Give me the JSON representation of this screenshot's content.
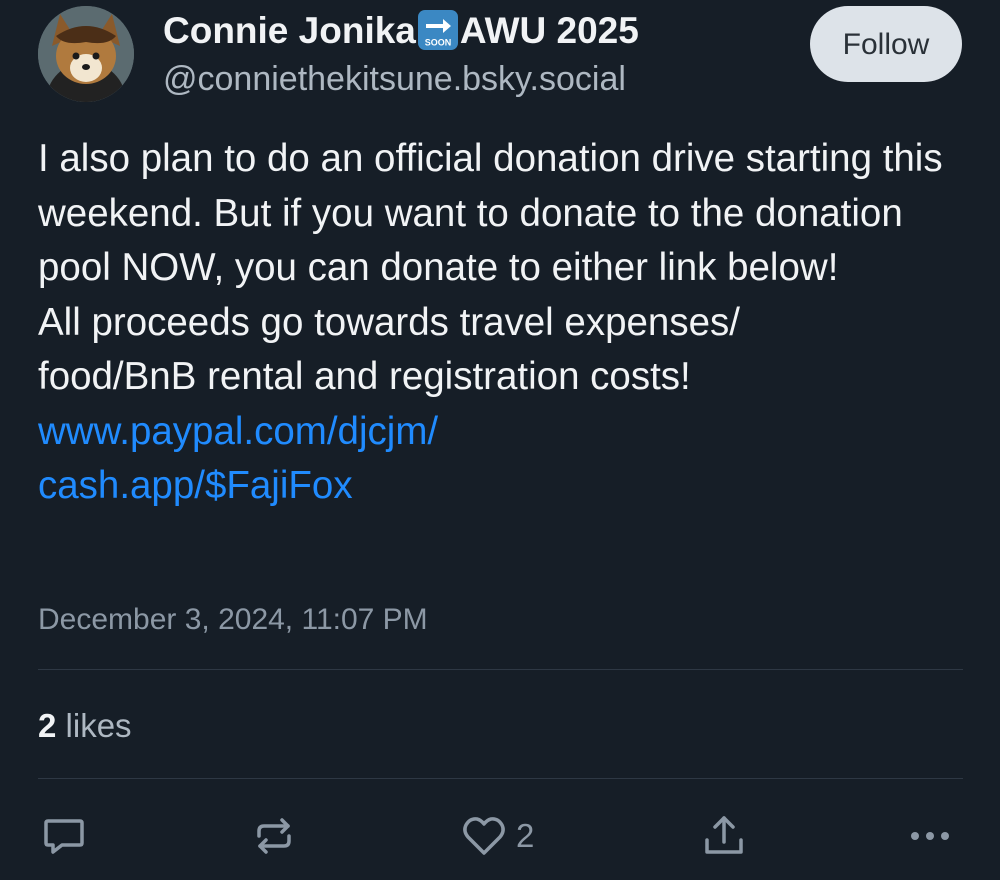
{
  "author": {
    "display_name_before": "Connie Jonika",
    "display_name_badge": "SOON",
    "display_name_after": "AWU 2025",
    "handle": "@conniethekitsune.bsky.social",
    "avatar_icon": "fox-avatar-icon"
  },
  "follow_label": "Follow",
  "post": {
    "text": "I also plan to do an official donation drive starting this weekend. But if you want to donate to the donation pool NOW, you can donate to either link below!\nAll proceeds go towards travel expenses/\nfood/BnB rental and registration costs!",
    "links": [
      "www.paypal.com/djcjm/",
      "cash.app/$FajiFox"
    ],
    "timestamp": "December 3, 2024, 11:07 PM"
  },
  "stats": {
    "likes_count": "2",
    "likes_label": "likes"
  },
  "actions": {
    "reply_icon": "reply-icon",
    "repost_icon": "repost-icon",
    "like_icon": "heart-icon",
    "like_count": "2",
    "share_icon": "share-icon",
    "more_icon": "more-icon"
  },
  "colors": {
    "background": "#161e27",
    "link": "#208bfe",
    "text_primary": "#f1f3f5",
    "text_secondary": "#8c98a5",
    "follow_button_bg": "#dde3e9"
  }
}
